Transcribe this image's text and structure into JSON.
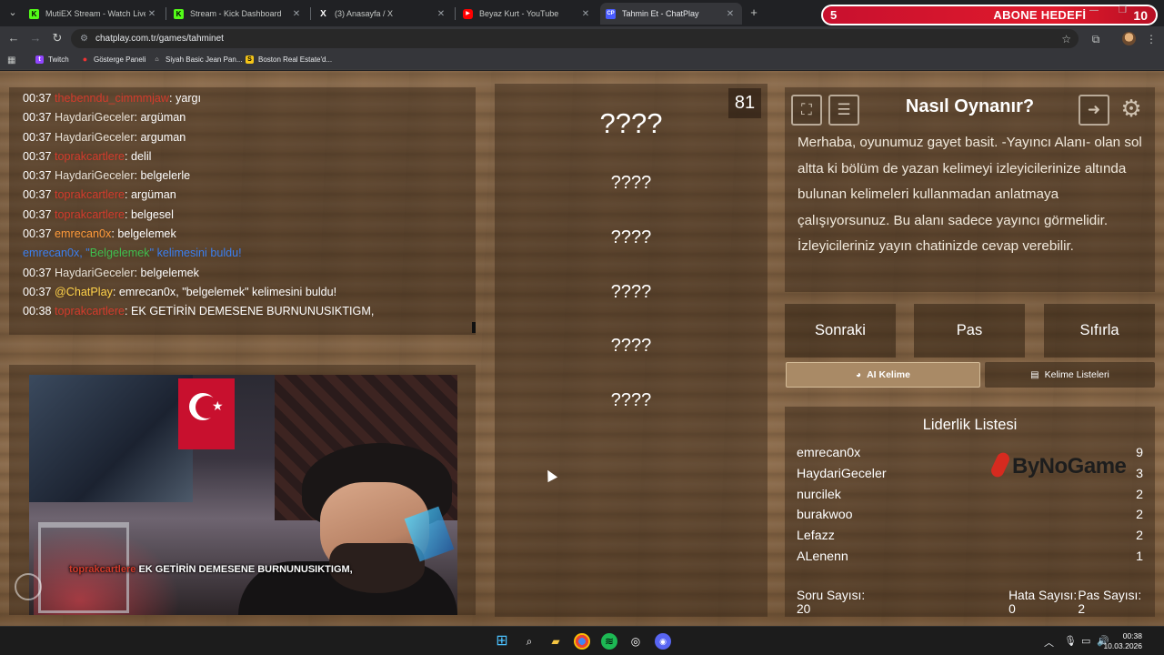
{
  "browser": {
    "tabs": [
      {
        "title": "MutiEX Stream - Watch Live on",
        "icon": "kick-icon",
        "color": "#53fc18"
      },
      {
        "title": "Stream - Kick Dashboard",
        "icon": "kick-icon",
        "color": "#53fc18"
      },
      {
        "title": "(3) Anasayfa / X",
        "icon": "x-icon",
        "color": "#ffffff"
      },
      {
        "title": "Beyaz Kurt - YouTube",
        "icon": "youtube-icon",
        "color": "#ff0000"
      },
      {
        "title": "Tahmin Et - ChatPlay",
        "icon": "chatplay-icon",
        "color": "#4a5cff",
        "active": true
      }
    ],
    "url": "chatplay.com.tr/games/tahminet",
    "bookmarks": [
      "Twitch",
      "Gösterge Paneli",
      "Siyah Basic Jean Pan...",
      "Boston Real Estate'd..."
    ]
  },
  "goal_overlay": {
    "current": "5",
    "label": "ABONE HEDEFİ",
    "target": "10"
  },
  "chat": {
    "messages": [
      {
        "time": "00:37",
        "user": "thebenndu_cimmmjaw",
        "user_color": "red",
        "text": "yargı"
      },
      {
        "time": "00:37",
        "user": "HaydariGeceler",
        "user_color": "gray",
        "text": "argüman"
      },
      {
        "time": "00:37",
        "user": "HaydariGeceler",
        "user_color": "gray",
        "text": "arguman"
      },
      {
        "time": "00:37",
        "user": "toprakcartlere",
        "user_color": "red",
        "text": "delil"
      },
      {
        "time": "00:37",
        "user": "HaydariGeceler",
        "user_color": "gray",
        "text": "belgelerle"
      },
      {
        "time": "00:37",
        "user": "toprakcartlere",
        "user_color": "red",
        "text": "argüman"
      },
      {
        "time": "00:37",
        "user": "toprakcartlere",
        "user_color": "red",
        "text": "belgesel"
      },
      {
        "time": "00:37",
        "user": "emrecan0x",
        "user_color": "orange",
        "text": "belgelemek"
      },
      {
        "system": true,
        "pre": "emrecan0x, \"",
        "keyword": "Belgelemek",
        "post": "\" kelimesini buldu!"
      },
      {
        "time": "00:37",
        "user": "HaydariGeceler",
        "user_color": "gray",
        "text": "belgelemek"
      },
      {
        "time": "00:37",
        "user": "@ChatPlay",
        "user_color": "yellow",
        "text": "emrecan0x, \"belgelemek\" kelimesini buldu!"
      },
      {
        "time": "00:38",
        "user": "toprakcartlere",
        "user_color": "red",
        "text": "EK GETİRİN DEMESENE BURNUNUSIKTIGM,"
      }
    ]
  },
  "webcam": {
    "caption_user": "toprakcartlere",
    "caption_text": "EK GETİRİN DEMESENE BURNUNUSIKTIGM,"
  },
  "game": {
    "score": "81",
    "words": [
      "????",
      "????",
      "????",
      "????",
      "????",
      "????"
    ]
  },
  "howto": {
    "title": "Nasıl Oynanır?",
    "text": "Merhaba, oyunumuz gayet basit. -Yayıncı Alanı- olan sol altta ki bölüm de yazan kelimeyi izleyicilerinize altında bulunan kelimeleri kullanmadan anlatmaya çalışıyorsunuz. Bu alanı sadece yayıncı görmelidir. İzleyicileriniz yayın chatinizde cevap verebilir.",
    "icons": [
      "fullscreen-icon",
      "document-icon",
      "exit-icon",
      "gear-icon"
    ]
  },
  "controls": {
    "next": "Sonraki",
    "pass": "Pas",
    "reset": "Sıfırla"
  },
  "list_tabs": {
    "ai": "AI Kelime",
    "lists": "Kelime Listeleri"
  },
  "leaderboard": {
    "title": "Liderlik Listesi",
    "rows": [
      {
        "name": "emrecan0x",
        "score": "9"
      },
      {
        "name": "HaydariGeceler",
        "score": "3"
      },
      {
        "name": "nurcilek",
        "score": "2"
      },
      {
        "name": "burakwoo",
        "score": "2"
      },
      {
        "name": "Lefazz",
        "score": "2"
      },
      {
        "name": "ALenenn",
        "score": "1"
      }
    ],
    "stats": {
      "questions": "Soru Sayısı: 20",
      "errors": "Hata Sayısı: 0",
      "passes": "Pas Sayısı: 2"
    },
    "watermark": "ByNoGame"
  },
  "taskbar": {
    "time": "00:38",
    "date": "10.03.2026"
  }
}
